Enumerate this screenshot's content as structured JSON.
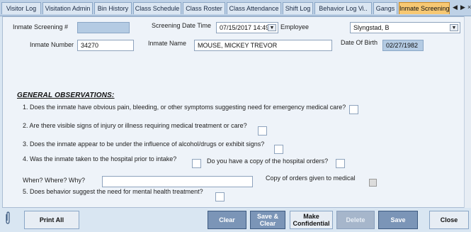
{
  "tabs": [
    "Visitor Log",
    "Visitation Admin",
    "Bin History",
    "Class Schedule",
    "Class Roster",
    "Class Attendance",
    "Shift Log",
    "Behavior Log Vi..",
    "Gangs",
    "Inmate Screening"
  ],
  "tab_nav": {
    "prev": "◀",
    "next": "▶",
    "close": "×"
  },
  "form": {
    "screening_num_label": "Inmate Screening #",
    "screening_num_value": "",
    "screening_dt_label": "Screening Date Time",
    "screening_dt_value": "07/15/2017 14:49",
    "employee_label": "Employee",
    "employee_value": "Slyngstad, B",
    "inmate_number_label": "Inmate Number",
    "inmate_number_value": "34270",
    "inmate_name_label": "Inmate Name",
    "inmate_name_value": "MOUSE, MICKEY TREVOR",
    "dob_label": "Date Of Birth",
    "dob_value": "02/27/1982"
  },
  "observations": {
    "heading": "GENERAL OBSERVATIONS:",
    "q1": "1. Does the inmate have obvious pain, bleeding, or other symptoms suggesting need for emergency medical care?",
    "q2": "2. Are there visible signs of injury or illness requiring medical treatment or care?",
    "q3": "3. Does the inmate appear to be under the influence of alcohol/drugs or exhibit signs?",
    "q4": "4. Was the inmate taken to the hospital prior to intake?",
    "q4b": "Do you have a copy of the hospital orders?",
    "when_label": "When? Where? Why?",
    "when_value": "",
    "copy_orders_label": "Copy of orders given to medical",
    "q5": "5. Does behavior suggest the need for mental health treatment?"
  },
  "buttons": {
    "print_all": "Print All",
    "clear": "Clear",
    "save_clear_1": "Save &",
    "save_clear_2": "Clear",
    "make_conf_1": "Make",
    "make_conf_2": "Confidential",
    "delete": "Delete",
    "save": "Save",
    "close": "Close"
  },
  "icons": {
    "attachment": "paperclip-icon",
    "dropdown": "chevron-down-icon"
  },
  "colors": {
    "active_tab": "#f7c873",
    "button": "#7b95b7",
    "readonly_field": "#b4cbe3"
  }
}
